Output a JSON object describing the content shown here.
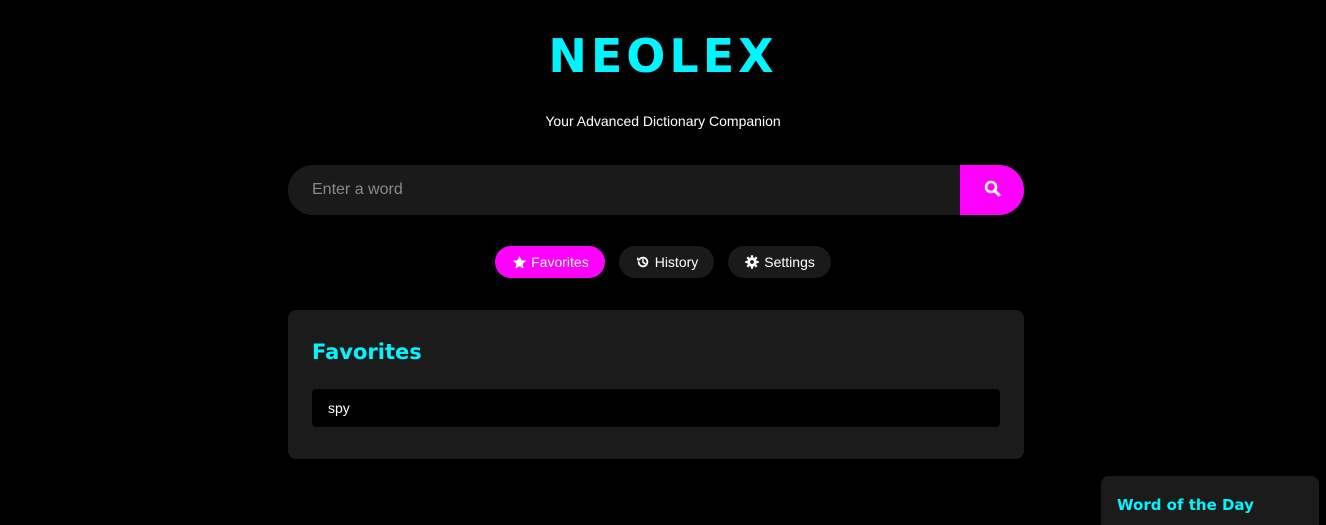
{
  "app": {
    "title": "NEOLEX",
    "tagline": "Your Advanced Dictionary Companion"
  },
  "search": {
    "placeholder": "Enter a word",
    "value": "",
    "button_icon": "search-icon"
  },
  "nav": {
    "items": [
      {
        "label": "Favorites",
        "icon": "star-icon",
        "active": true
      },
      {
        "label": "History",
        "icon": "history-icon",
        "active": false
      },
      {
        "label": "Settings",
        "icon": "gear-icon",
        "active": false
      }
    ]
  },
  "favorites_panel": {
    "title": "Favorites",
    "items": [
      "spy"
    ]
  },
  "word_of_the_day": {
    "title": "Word of the Day"
  },
  "colors": {
    "background": "#000000",
    "accent_cyan": "#00f5ff",
    "accent_magenta": "#ff00ff",
    "surface": "#1a1a1a"
  }
}
